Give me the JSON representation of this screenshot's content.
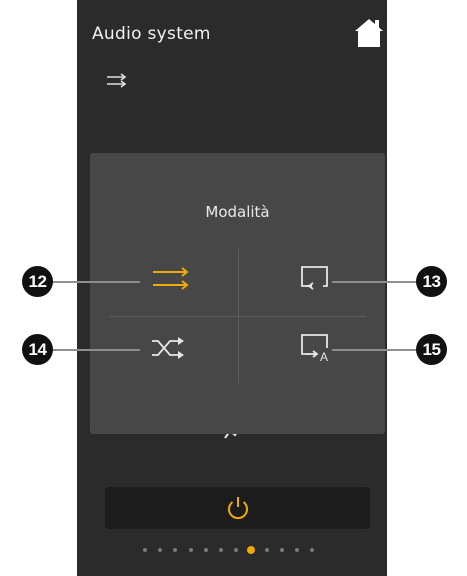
{
  "app": {
    "title": "Audio system"
  },
  "icons": {
    "home": "home-icon",
    "mode_indicator": "repeat-all-icon",
    "power": "power-icon"
  },
  "modal": {
    "title": "Modalità",
    "options": [
      {
        "id": "repeat-all",
        "icon": "repeat-all-icon",
        "selected": true
      },
      {
        "id": "repeat-one",
        "icon": "repeat-icon",
        "selected": false
      },
      {
        "id": "shuffle",
        "icon": "shuffle-icon",
        "selected": false
      },
      {
        "id": "repeat-album",
        "icon": "repeat-album-icon",
        "badge_letter": "A",
        "selected": false
      }
    ]
  },
  "callouts": [
    "12",
    "13",
    "14",
    "15"
  ],
  "pagination": {
    "total": 12,
    "active_index": 7
  },
  "colors": {
    "accent": "#f2a900",
    "background": "#2b2b2b",
    "modal": "#474747",
    "text": "#f2f2f2"
  }
}
